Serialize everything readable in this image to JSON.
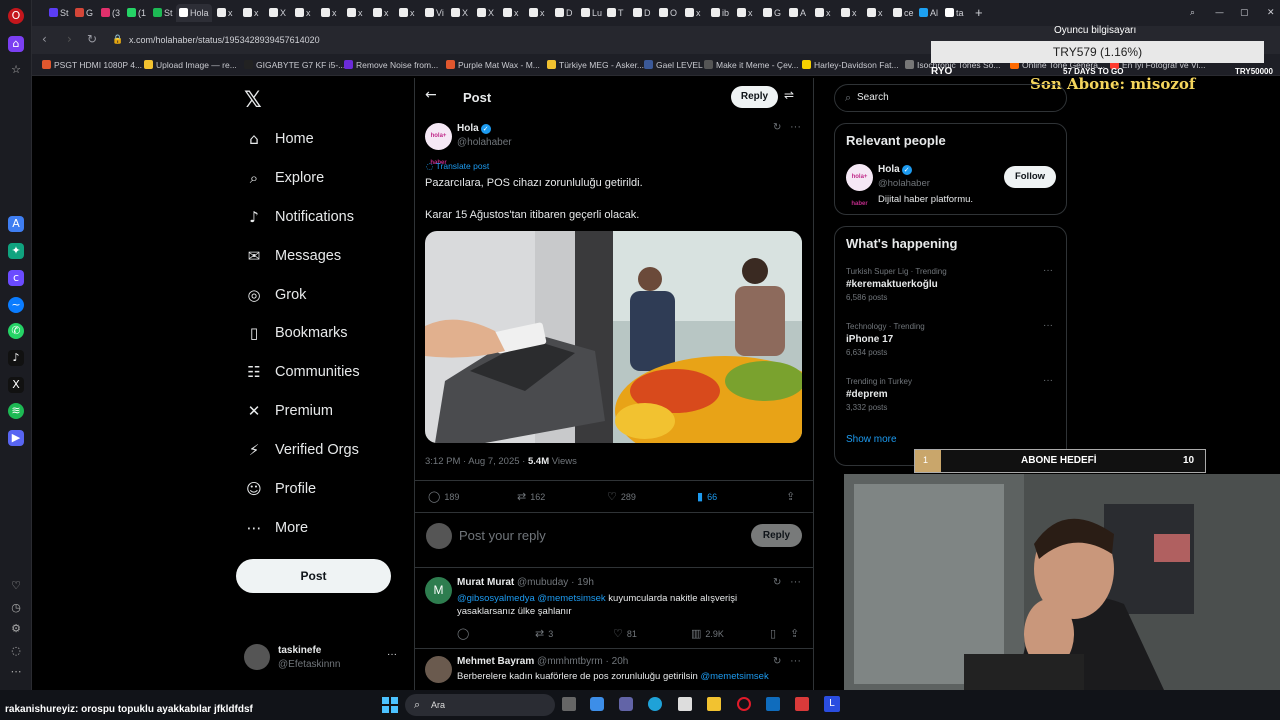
{
  "browser": {
    "tabs": [
      "St",
      "G",
      "(3",
      "(1",
      "St",
      "Hola",
      "x",
      "x",
      "X",
      "x",
      "x",
      "x",
      "x",
      "x",
      "Vi",
      "X",
      "X",
      "x",
      "x",
      "D",
      "Lu",
      "T",
      "D",
      "O",
      "x",
      "ib",
      "x",
      "G",
      "A",
      "x",
      "x",
      "x",
      "ce",
      "Al",
      "ta"
    ],
    "url": "x.com/holahaber/status/1953428939457614020",
    "bookmarks": [
      "PSGT HDMI 1080P 4...",
      "Upload Image — re...",
      "GIGABYTE G7 KF i5-...",
      "Remove Noise from...",
      "Purple Mat Wax - M...",
      "Türkiye MEG - Asker...",
      "Gael LEVEL",
      "Make it Meme - Çev...",
      "Harley-Davidson Fat...",
      "Isochronic Tones So...",
      "Online Tone Genera...",
      "En İyi Fotoğraf ve Vi..."
    ]
  },
  "overlay": {
    "top_text": "Oyuncu bilgisayarı",
    "price": "TRY579 (1.16%)",
    "left_label": "RYO",
    "days": "57 DAYS TO GO",
    "right_label": "TRY50000",
    "subtitle": "Son Abone: misozof",
    "goal_label": "ABONE HEDEFİ",
    "goal_current": "1",
    "goal_target": "10",
    "chat_user": "rakanishureyiz",
    "chat_message": ": orospu topuklu ayakkabılar jfkldfdsf",
    "taskbar_search": "Ara"
  },
  "nav": {
    "items": [
      {
        "label": "Home",
        "icon": "home-icon"
      },
      {
        "label": "Explore",
        "icon": "search-icon"
      },
      {
        "label": "Notifications",
        "icon": "bell-icon"
      },
      {
        "label": "Messages",
        "icon": "mail-icon"
      },
      {
        "label": "Grok",
        "icon": "grok-icon"
      },
      {
        "label": "Bookmarks",
        "icon": "bookmark-icon"
      },
      {
        "label": "Communities",
        "icon": "communities-icon"
      },
      {
        "label": "Premium",
        "icon": "x-icon"
      },
      {
        "label": "Verified Orgs",
        "icon": "lightning-icon"
      },
      {
        "label": "Profile",
        "icon": "person-icon"
      },
      {
        "label": "More",
        "icon": "more-circle-icon"
      }
    ],
    "post_button": "Post",
    "account_name": "taskinefe",
    "account_handle": "@Efetaskinnn",
    "more_dots": "···"
  },
  "post": {
    "header_title": "Post",
    "reply_button": "Reply",
    "author_name": "Hola",
    "author_handle": "@holahaber",
    "avatar_text": "hola+ haber",
    "translate": "Translate post",
    "text_line1": "Pazarcılara, POS cihazı zorunluluğu getirildi.",
    "text_line2": "Karar 15 Ağustos'tan itibaren geçerli olacak.",
    "time": "3:12 PM · Aug 7, 2025 · ",
    "views_count": "5.4M",
    "views_label": " Views",
    "replies": "189",
    "reposts": "162",
    "likes": "289",
    "bookmarks": "66",
    "reply_placeholder": "Post your reply",
    "reply_submit": "Reply"
  },
  "replies": [
    {
      "name": "Murat Murat",
      "handle": "@mubuday · 19h",
      "avatar_letter": "M",
      "mention": "@gibsosyalmedya @memetsimsek",
      "text": " kuyumcularda nakitle alışverişi yasaklarsanız ülke şahlanır",
      "reposts": "3",
      "likes": "81",
      "views": "2.9K"
    },
    {
      "name": "Mehmet Bayram",
      "handle": "@mmhmtbyrm · 20h",
      "text": "Berberelere kadın kuaförlere de pos zorunluluğu getirilsin ",
      "mention": "@memetsimsek"
    }
  ],
  "sidebar": {
    "search_placeholder": "Search",
    "relevant_title": "Relevant people",
    "person_name": "Hola",
    "person_handle": "@holahaber",
    "person_bio": "Dijital haber platformu.",
    "follow_button": "Follow",
    "happening_title": "What's happening",
    "trends": [
      {
        "meta": "Turkish Super Lig · Trending",
        "name": "#keremaktuerkoğlu",
        "posts": "6,586 posts"
      },
      {
        "meta": "Technology · Trending",
        "name": "iPhone 17",
        "posts": "6,634 posts"
      },
      {
        "meta": "Trending in Turkey",
        "name": "#deprem",
        "posts": "3,332 posts"
      }
    ],
    "show_more": "Show more"
  }
}
